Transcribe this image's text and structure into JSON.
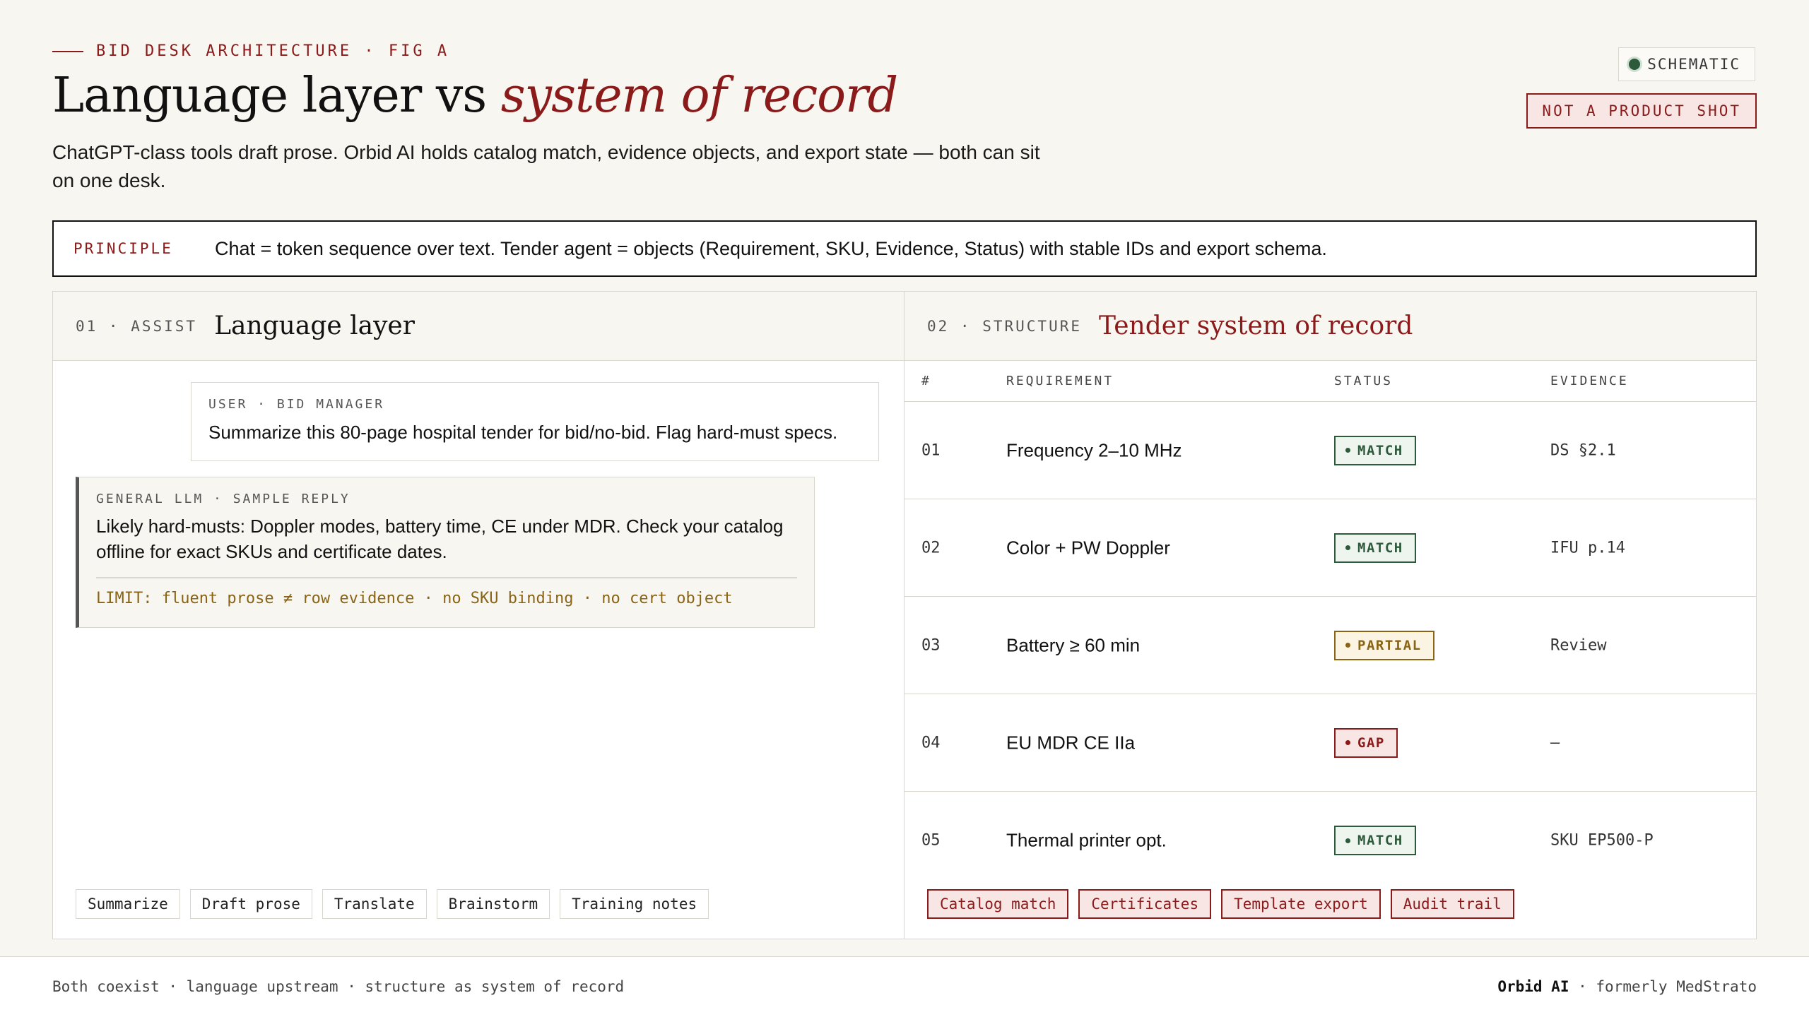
{
  "header": {
    "eyebrow": "BID DESK ARCHITECTURE · FIG A",
    "title_main": "Language layer vs ",
    "title_accent": "system of record",
    "subtitle": "ChatGPT-class tools draft prose. Orbid AI holds catalog match, evidence objects, and export state — both can sit on one desk.",
    "badge_schematic": "SCHEMATIC",
    "badge_not_product": "NOT A PRODUCT SHOT"
  },
  "principle": {
    "label": "PRINCIPLE",
    "text": "Chat = token sequence over text. Tender agent = objects (Requirement, SKU, Evidence, Status) with stable IDs and export schema."
  },
  "left_panel": {
    "num": "01 · ASSIST",
    "name": "Language layer",
    "user_label": "USER · BID MANAGER",
    "user_text": "Summarize this 80-page hospital tender for bid/no-bid. Flag hard-must specs.",
    "llm_label": "GENERAL LLM · SAMPLE REPLY",
    "llm_text": "Likely hard-musts: Doppler modes, battery time, CE under MDR. Check your catalog offline for exact SKUs and certificate dates.",
    "limit": "LIMIT: fluent prose ≠ row evidence · no SKU binding · no cert object",
    "chips": [
      "Summarize",
      "Draft prose",
      "Translate",
      "Brainstorm",
      "Training notes"
    ]
  },
  "right_panel": {
    "num": "02 · STRUCTURE",
    "name": "Tender system of record",
    "columns": [
      "#",
      "REQUIREMENT",
      "STATUS",
      "EVIDENCE"
    ],
    "rows": [
      {
        "id": "01",
        "requirement": "Frequency 2–10 MHz",
        "status": "MATCH",
        "evidence": "DS §2.1"
      },
      {
        "id": "02",
        "requirement": "Color + PW Doppler",
        "status": "MATCH",
        "evidence": "IFU p.14"
      },
      {
        "id": "03",
        "requirement": "Battery ≥ 60 min",
        "status": "PARTIAL",
        "evidence": "Review"
      },
      {
        "id": "04",
        "requirement": "EU MDR CE IIa",
        "status": "GAP",
        "evidence": "—"
      },
      {
        "id": "05",
        "requirement": "Thermal printer opt.",
        "status": "MATCH",
        "evidence": "SKU EP500-P"
      }
    ],
    "chips": [
      "Catalog match",
      "Certificates",
      "Template export",
      "Audit trail"
    ]
  },
  "footer": {
    "left": "Both coexist · language upstream · structure as system of record",
    "brand": "Orbid AI",
    "right_suffix": " · formerly MedStrato"
  },
  "colors": {
    "accent": "#8b1a1a",
    "match": "#2e5a3c",
    "partial": "#8a6414",
    "gap": "#8b1a1a",
    "background": "#f8f6f1"
  }
}
